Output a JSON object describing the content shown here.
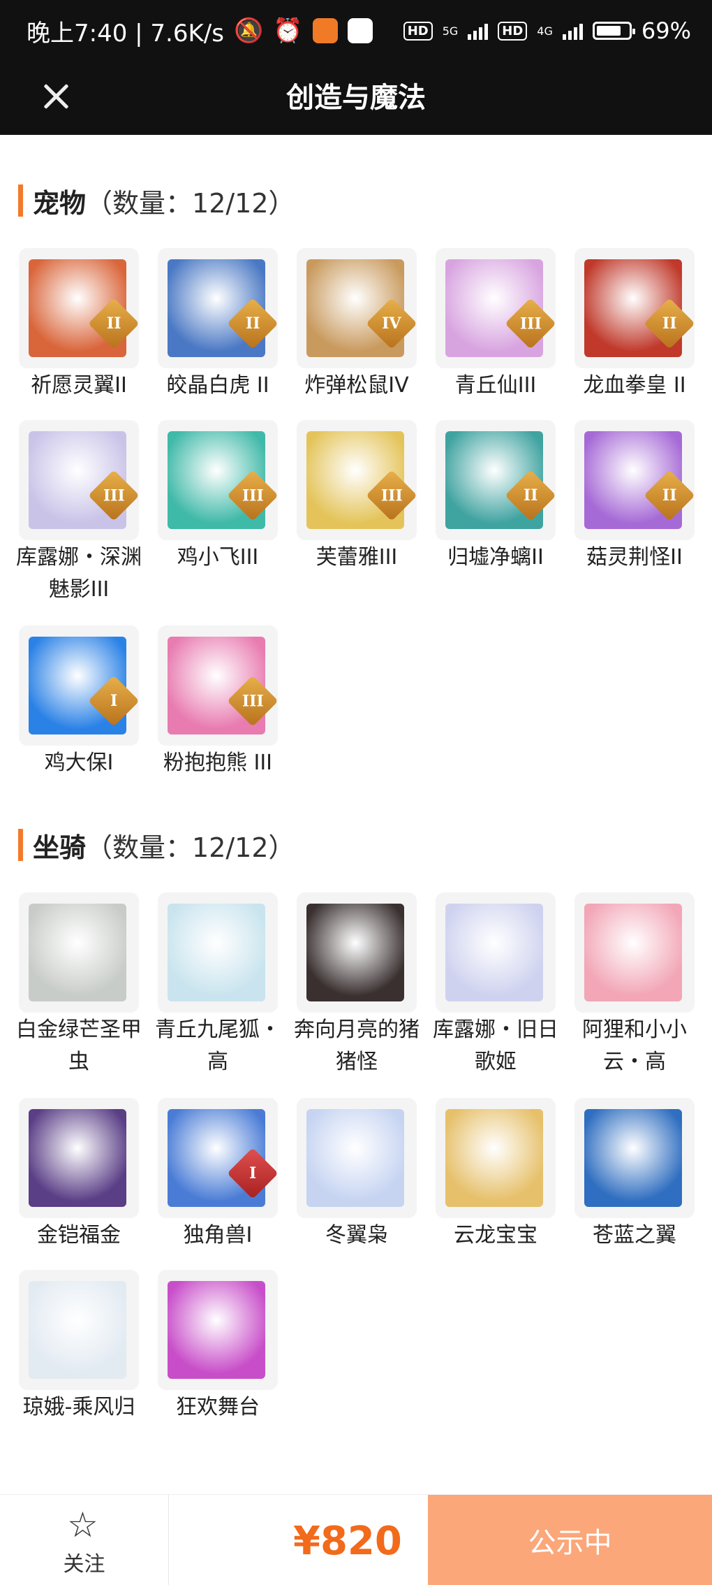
{
  "status_bar": {
    "time_speed": "晚上7:40 | 7.6K/s",
    "hd1": "HD",
    "net1": "5G",
    "hd2": "HD",
    "net2": "4G",
    "battery": "69%"
  },
  "header": {
    "title": "创造与魔法"
  },
  "sections": [
    {
      "name": "宠物",
      "count": "（数量：12/12）",
      "items": [
        {
          "label": "祈愿灵翼II",
          "badge": "II",
          "color": "#d9653a",
          "badge_color": "gold"
        },
        {
          "label": "皎晶白虎 II",
          "badge": "II",
          "color": "#4a78c4",
          "badge_color": "gold"
        },
        {
          "label": "炸弹松鼠IV",
          "badge": "IV",
          "color": "#c99a5e",
          "badge_color": "gold"
        },
        {
          "label": "青丘仙III",
          "badge": "III",
          "color": "#d8a4e0",
          "badge_color": "gold"
        },
        {
          "label": "龙血拳皇 II",
          "badge": "II",
          "color": "#c0392b",
          "badge_color": "gold"
        },
        {
          "label": "库露娜・深渊魅影III",
          "badge": "III",
          "color": "#c9c3e8",
          "badge_color": "gold"
        },
        {
          "label": "鸡小飞III",
          "badge": "III",
          "color": "#3fb9a8",
          "badge_color": "gold"
        },
        {
          "label": "芙蕾雅III",
          "badge": "III",
          "color": "#e4c45a",
          "badge_color": "gold"
        },
        {
          "label": "归墟净螭II",
          "badge": "II",
          "color": "#3fa3a0",
          "badge_color": "gold"
        },
        {
          "label": "菇灵荆怪II",
          "badge": "II",
          "color": "#a66ad6",
          "badge_color": "gold"
        },
        {
          "label": "鸡大保I",
          "badge": "I",
          "color": "#2b82e6",
          "badge_color": "gold"
        },
        {
          "label": "粉抱抱熊 III",
          "badge": "III",
          "color": "#e87bb0",
          "badge_color": "gold"
        }
      ]
    },
    {
      "name": "坐骑",
      "count": "（数量：12/12）",
      "items": [
        {
          "label": "白金绿芒圣甲虫",
          "badge": "",
          "color": "#c8ccc8"
        },
        {
          "label": "青丘九尾狐・高",
          "badge": "",
          "color": "#c9e4ee"
        },
        {
          "label": "奔向月亮的猪猪怪",
          "badge": "",
          "color": "#3a3030"
        },
        {
          "label": "库露娜・旧日歌姬",
          "badge": "",
          "color": "#cfd2ef"
        },
        {
          "label": "阿狸和小小云・高",
          "badge": "",
          "color": "#f2a6b6"
        },
        {
          "label": "金铠福金",
          "badge": "",
          "color": "#5a3e86"
        },
        {
          "label": "独角兽I",
          "badge": "I",
          "color": "#4a7cd6",
          "badge_color": "red"
        },
        {
          "label": "冬翼枭",
          "badge": "",
          "color": "#c6d4f2"
        },
        {
          "label": "云龙宝宝",
          "badge": "",
          "color": "#e6c06a"
        },
        {
          "label": "苍蓝之翼",
          "badge": "",
          "color": "#2f6ec0"
        },
        {
          "label": "琼娥-乘风归",
          "badge": "",
          "color": "#e2eaf2"
        },
        {
          "label": "狂欢舞台",
          "badge": "",
          "color": "#c84ec9"
        }
      ]
    }
  ],
  "bottom": {
    "follow_label": "关注",
    "price": "¥820",
    "cta_label": "公示中"
  }
}
